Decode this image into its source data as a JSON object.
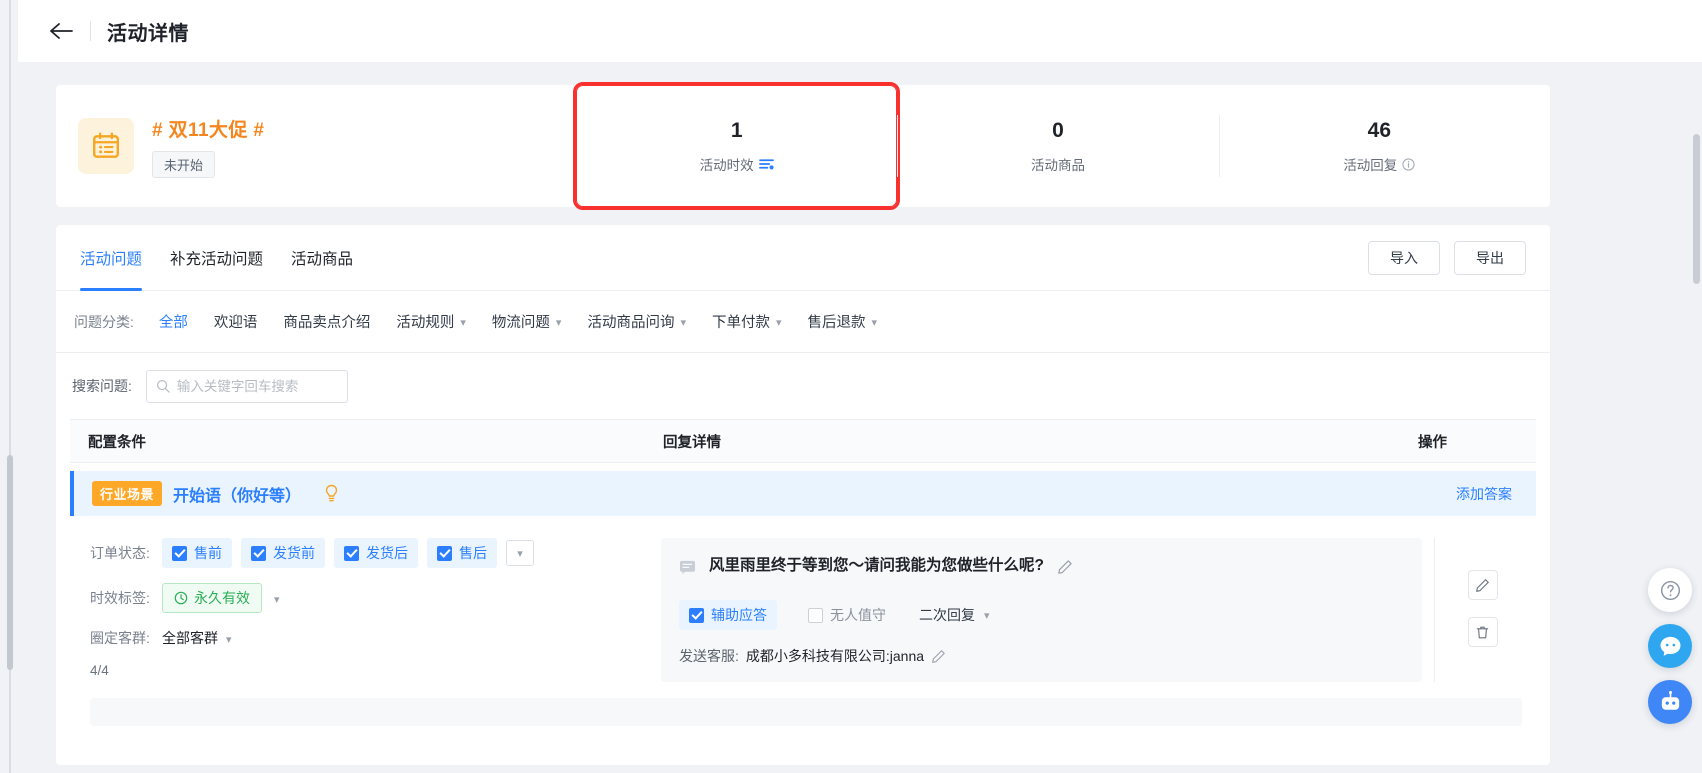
{
  "header": {
    "back_icon": "arrow-left-icon",
    "title": "活动详情"
  },
  "summary": {
    "campaign_icon": "calendar-list-icon",
    "campaign_name": "# 双11大促 #",
    "status": "未开始",
    "stats": [
      {
        "value": "1",
        "label": "活动时效",
        "icon": "settings-slider-icon",
        "highlighted": true
      },
      {
        "value": "0",
        "label": "活动商品",
        "icon": "",
        "highlighted": false
      },
      {
        "value": "46",
        "label": "活动回复",
        "icon": "info-circle-icon",
        "highlighted": false
      }
    ],
    "highlight_color": "#f8312f"
  },
  "tabs": {
    "items": [
      {
        "label": "活动问题",
        "active": true
      },
      {
        "label": "补充活动问题",
        "active": false
      },
      {
        "label": "活动商品",
        "active": false
      }
    ],
    "import_label": "导入",
    "export_label": "导出"
  },
  "filters": {
    "label": "问题分类:",
    "items": [
      {
        "label": "全部",
        "active": true,
        "caret": false
      },
      {
        "label": "欢迎语",
        "active": false,
        "caret": false
      },
      {
        "label": "商品卖点介绍",
        "active": false,
        "caret": false
      },
      {
        "label": "活动规则",
        "active": false,
        "caret": true
      },
      {
        "label": "物流问题",
        "active": false,
        "caret": true
      },
      {
        "label": "活动商品问询",
        "active": false,
        "caret": true
      },
      {
        "label": "下单付款",
        "active": false,
        "caret": true
      },
      {
        "label": "售后退款",
        "active": false,
        "caret": true
      }
    ]
  },
  "search": {
    "label": "搜索问题:",
    "placeholder": "输入关键字回车搜索",
    "value": "",
    "icon": "search-icon"
  },
  "table": {
    "columns": [
      "配置条件",
      "回复详情",
      "操作"
    ],
    "group": {
      "tag": "行业场景",
      "title": "开始语（你好等）",
      "hint_icon": "lightbulb-icon",
      "action": "添加答案"
    },
    "row": {
      "conditions": {
        "order_status_label": "订单状态:",
        "order_status_options": [
          {
            "label": "售前",
            "checked": true
          },
          {
            "label": "发货前",
            "checked": true
          },
          {
            "label": "发货后",
            "checked": true
          },
          {
            "label": "售后",
            "checked": true
          }
        ],
        "more_icon": "chevron-down-icon",
        "validity_label": "时效标签:",
        "validity_tag": "永久有效",
        "validity_icon": "clock-icon",
        "validity_caret": "chevron-down-icon",
        "audience_label": "圈定客群:",
        "audience_value": "全部客群",
        "audience_caret": "chevron-down-icon",
        "count": "4/4"
      },
      "reply": {
        "message_icon": "message-icon",
        "text": "风里雨里终于等到您～请问我能为您做些什么呢?",
        "edit_icon": "pencil-icon",
        "options": [
          {
            "label": "辅助应答",
            "checked": true,
            "style": "checkbox"
          },
          {
            "label": "无人值守",
            "checked": false,
            "style": "checkbox"
          },
          {
            "label": "二次回复",
            "checked": false,
            "style": "dropdown"
          }
        ],
        "sender_label": "发送客服:",
        "sender_value": "成都小多科技有限公司:janna",
        "sender_edit_icon": "pencil-icon"
      },
      "operations": [
        {
          "icon": "pencil-icon",
          "name": "edit"
        },
        {
          "icon": "trash-icon",
          "name": "delete"
        }
      ]
    }
  },
  "floating": {
    "help": "help-circle-icon",
    "chat": "chat-smile-icon",
    "robot": "robot-icon"
  }
}
